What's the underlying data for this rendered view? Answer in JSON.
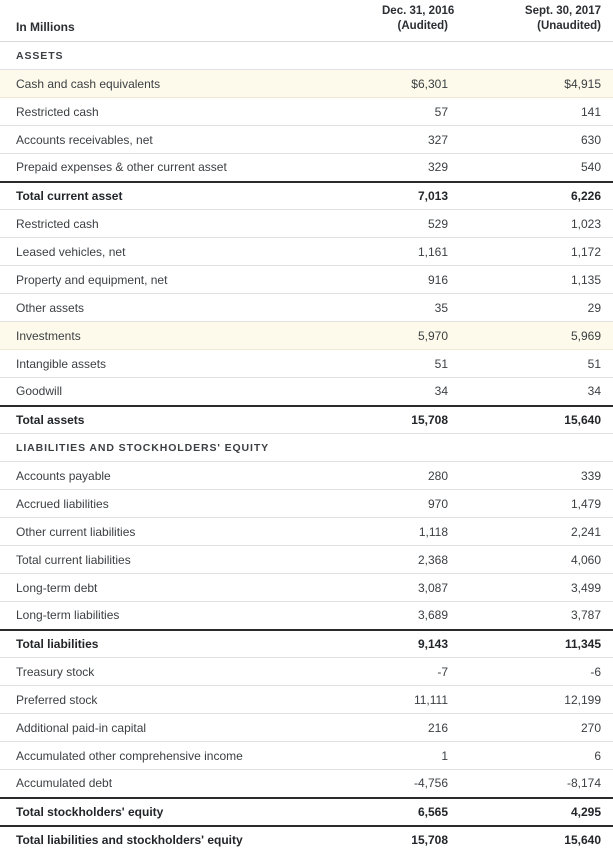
{
  "table": {
    "header": {
      "label": "In Millions",
      "columns": [
        {
          "date": "Dec. 31, 2016",
          "audit_status": "(Audited)"
        },
        {
          "date": "Sept. 30, 2017",
          "audit_status": "(Unaudited)"
        }
      ]
    },
    "rows": [
      {
        "label": "ASSETS",
        "v1": "",
        "v2": "",
        "type": "section"
      },
      {
        "label": "Cash and cash equivalents",
        "v1": "$6,301",
        "v2": "$4,915",
        "type": "highlight"
      },
      {
        "label": "Restricted cash",
        "v1": "57",
        "v2": "141",
        "type": "normal"
      },
      {
        "label": "Accounts receivables, net",
        "v1": "327",
        "v2": "630",
        "type": "normal"
      },
      {
        "label": "Prepaid expenses & other current asset",
        "v1": "329",
        "v2": "540",
        "type": "normal"
      },
      {
        "label": "Total current asset",
        "v1": "7,013",
        "v2": "6,226",
        "type": "total"
      },
      {
        "label": "Restricted cash",
        "v1": "529",
        "v2": "1,023",
        "type": "normal"
      },
      {
        "label": "Leased vehicles, net",
        "v1": "1,161",
        "v2": "1,172",
        "type": "normal"
      },
      {
        "label": "Property and equipment, net",
        "v1": "916",
        "v2": "1,135",
        "type": "normal"
      },
      {
        "label": "Other assets",
        "v1": "35",
        "v2": "29",
        "type": "normal"
      },
      {
        "label": "Investments",
        "v1": "5,970",
        "v2": "5,969",
        "type": "highlight"
      },
      {
        "label": "Intangible assets",
        "v1": "51",
        "v2": "51",
        "type": "normal"
      },
      {
        "label": "Goodwill",
        "v1": "34",
        "v2": "34",
        "type": "normal"
      },
      {
        "label": "Total assets",
        "v1": "15,708",
        "v2": "15,640",
        "type": "total"
      },
      {
        "label": "LIABILITIES AND STOCKHOLDERS' EQUITY",
        "v1": "",
        "v2": "",
        "type": "section"
      },
      {
        "label": "Accounts payable",
        "v1": "280",
        "v2": "339",
        "type": "normal"
      },
      {
        "label": "Accrued liabilities",
        "v1": "970",
        "v2": "1,479",
        "type": "normal"
      },
      {
        "label": "Other current liabilities",
        "v1": "1,118",
        "v2": "2,241",
        "type": "normal"
      },
      {
        "label": "Total current liabilities",
        "v1": "2,368",
        "v2": "4,060",
        "type": "normal"
      },
      {
        "label": "Long-term debt",
        "v1": "3,087",
        "v2": "3,499",
        "type": "normal"
      },
      {
        "label": "Long-term liabilities",
        "v1": "3,689",
        "v2": "3,787",
        "type": "normal"
      },
      {
        "label": "Total liabilities",
        "v1": "9,143",
        "v2": "11,345",
        "type": "total"
      },
      {
        "label": "Treasury stock",
        "v1": "-7",
        "v2": "-6",
        "type": "normal"
      },
      {
        "label": "Preferred stock",
        "v1": "11,111",
        "v2": "12,199",
        "type": "normal"
      },
      {
        "label": "Additional paid-in capital",
        "v1": "216",
        "v2": "270",
        "type": "normal"
      },
      {
        "label": "Accumulated other comprehensive income",
        "v1": "1",
        "v2": "6",
        "type": "normal"
      },
      {
        "label": "Accumulated debt",
        "v1": "-4,756",
        "v2": "-8,174",
        "type": "normal"
      },
      {
        "label": "Total stockholders' equity",
        "v1": "6,565",
        "v2": "4,295",
        "type": "total"
      },
      {
        "label": "Total liabilities and stockholders' equity",
        "v1": "15,708",
        "v2": "15,640",
        "type": "total"
      }
    ]
  },
  "colors": {
    "highlight_background": "#fdfaeb",
    "text": "#3c4043",
    "total_text": "#22262a",
    "rule_light": "#e2e2e2",
    "rule_dark": "#2b2b2b"
  }
}
